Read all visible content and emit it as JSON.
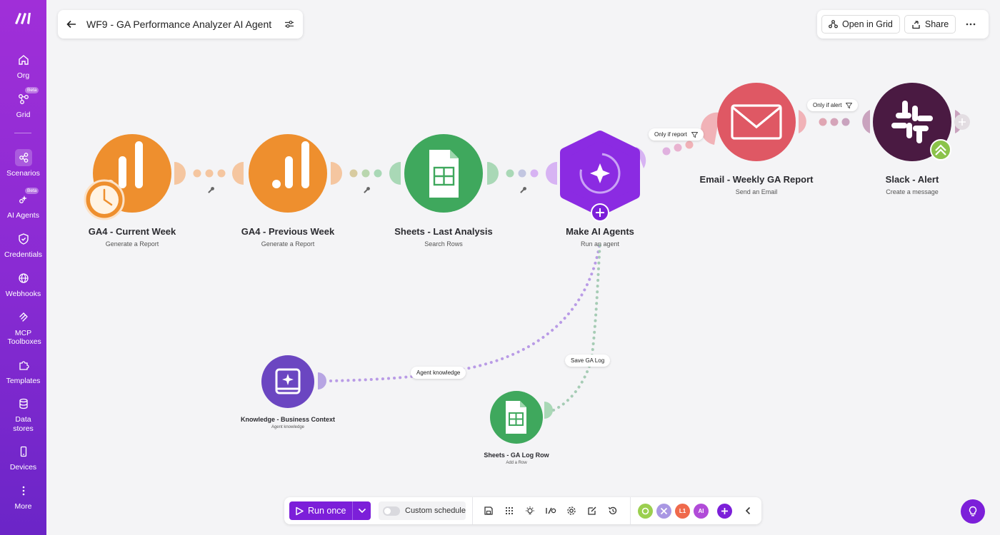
{
  "sidebar": {
    "items": [
      {
        "label": "Org",
        "icon": "home-icon"
      },
      {
        "label": "Grid",
        "icon": "grid-icon",
        "badge": "Beta"
      },
      {
        "label": "Scenarios",
        "icon": "share-icon"
      },
      {
        "label": "AI Agents",
        "icon": "ai-agents-icon",
        "badge": "Beta"
      },
      {
        "label": "Credentials",
        "icon": "shield-icon"
      },
      {
        "label": "Webhooks",
        "icon": "globe-icon"
      },
      {
        "label": "MCP Toolboxes",
        "icon": "mcp-icon"
      },
      {
        "label": "Templates",
        "icon": "puzzle-icon"
      },
      {
        "label": "Data stores",
        "icon": "database-icon"
      },
      {
        "label": "Devices",
        "icon": "phone-icon"
      },
      {
        "label": "More",
        "icon": "more-vertical-icon"
      }
    ]
  },
  "header": {
    "title": "WF9 - GA Performance Analyzer AI Agent",
    "open_in_grid": "Open in Grid",
    "share": "Share"
  },
  "nodes": {
    "ga4_current": {
      "title": "GA4 - Current Week",
      "subtitle": "Generate a Report"
    },
    "ga4_previous": {
      "title": "GA4 - Previous Week",
      "subtitle": "Generate a Report"
    },
    "sheets_last": {
      "title": "Sheets - Last Analysis",
      "subtitle": "Search Rows"
    },
    "ai_agents": {
      "title": "Make AI Agents",
      "subtitle": "Run an agent"
    },
    "email": {
      "title": "Email - Weekly GA Report",
      "subtitle": "Send an Email"
    },
    "slack": {
      "title": "Slack - Alert",
      "subtitle": "Create a message"
    },
    "knowledge": {
      "title": "Knowledge - Business Context",
      "subtitle": "Agent knowledge"
    },
    "sheets_log": {
      "title": "Sheets - GA Log Row",
      "subtitle": "Add a Row"
    }
  },
  "filters": {
    "only_if_report": "Only if report",
    "only_if_alert": "Only if alert",
    "agent_knowledge": "Agent knowledge",
    "save_ga_log": "Save GA Log"
  },
  "toolbar": {
    "run_once": "Run once",
    "custom_schedule": "Custom schedule",
    "avatars": [
      "",
      "",
      "L1",
      "AI"
    ]
  },
  "colors": {
    "ga_orange": "#ee8f2e",
    "sheets_green": "#3fa85d",
    "ai_purple": "#8b2be2",
    "email_red": "#df5864",
    "slack_dark": "#4a1a42",
    "knowledge_purple": "#6b46c1",
    "brand_purple": "#7c1fd9"
  }
}
